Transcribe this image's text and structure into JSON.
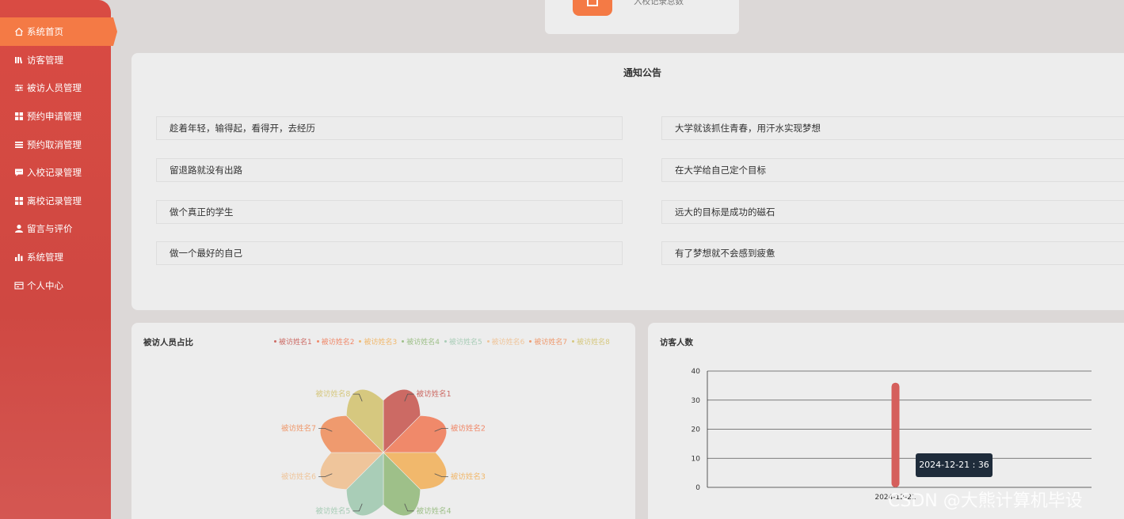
{
  "sidebar": {
    "items": [
      {
        "label": "系统首页",
        "icon": "home-icon"
      },
      {
        "label": "访客管理",
        "icon": "library-icon"
      },
      {
        "label": "被访人员管理",
        "icon": "sliders-icon"
      },
      {
        "label": "预约申请管理",
        "icon": "grid-icon"
      },
      {
        "label": "预约取消管理",
        "icon": "list-icon"
      },
      {
        "label": "入校记录管理",
        "icon": "chat-icon"
      },
      {
        "label": "离校记录管理",
        "icon": "grid-icon"
      },
      {
        "label": "留言与评价",
        "icon": "user-icon"
      },
      {
        "label": "系统管理",
        "icon": "bar-chart-icon"
      },
      {
        "label": "个人中心",
        "icon": "card-icon"
      }
    ]
  },
  "stat": {
    "label": "入校记录总数"
  },
  "notice": {
    "title": "通知公告",
    "items": [
      "趁着年轻，输得起，看得开，去经历",
      "大学就该抓住青春，用汗水实现梦想",
      "留退路就没有出路",
      "在大学给自己定个目标",
      "做个真正的学生",
      "远大的目标是成功的磁石",
      "做一个最好的自己",
      "有了梦想就不会感到疲惫"
    ]
  },
  "colors": {
    "accent": "#f47a45",
    "sidebar": "#d04a43",
    "series": [
      "#cc6a64",
      "#f0896a",
      "#f1b86c",
      "#9ec089",
      "#a9cdb7",
      "#efc59b",
      "#ef9a6e",
      "#d6c87f"
    ]
  },
  "pie": {
    "title": "被访人员占比",
    "chart_data": {
      "type": "pie",
      "variant": "rose",
      "categories": [
        "被访姓名1",
        "被访姓名2",
        "被访姓名3",
        "被访姓名4",
        "被访姓名5",
        "被访姓名6",
        "被访姓名7",
        "被访姓名8"
      ],
      "values": [
        1,
        1,
        1,
        1,
        1,
        1,
        1,
        1
      ],
      "legend": "top-right"
    }
  },
  "bar": {
    "title": "访客人数",
    "chart_data": {
      "type": "bar",
      "categories": [
        "2024-12-21"
      ],
      "values": [
        36
      ],
      "ylim": [
        0,
        40
      ],
      "yticks": [
        0,
        10,
        20,
        30,
        40
      ],
      "grid": true
    },
    "tooltip": "2024-12-21 : 36"
  },
  "watermark": "CSDN @大熊计算机毕设"
}
